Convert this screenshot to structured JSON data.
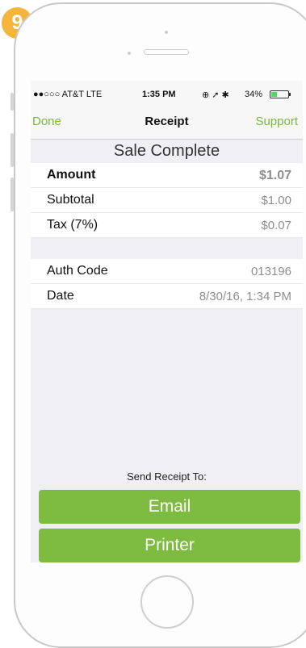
{
  "step_badge": "9",
  "status_bar": {
    "carrier": "●●○○○ AT&T  LTE",
    "time": "1:35 PM",
    "indicators": "⊕ ➚ ✱",
    "battery_percent": "34%",
    "battery_level": 0.34
  },
  "nav": {
    "left_label": "Done",
    "title": "Receipt",
    "right_label": "Support"
  },
  "receipt": {
    "heading": "Sale Complete",
    "amount": {
      "label": "Amount",
      "value": "$1.07"
    },
    "subtotal": {
      "label": "Subtotal",
      "value": "$1.00"
    },
    "tax": {
      "label": "Tax (7%)",
      "value": "$0.07"
    },
    "auth_code": {
      "label": "Auth Code",
      "value": "013196"
    },
    "date": {
      "label": "Date",
      "value": "8/30/16, 1:34 PM"
    }
  },
  "send": {
    "label": "Send Receipt To:",
    "email_button": "Email",
    "printer_button": "Printer"
  },
  "colors": {
    "accent_green": "#7dbc41",
    "badge_orange": "#f4b53a"
  }
}
